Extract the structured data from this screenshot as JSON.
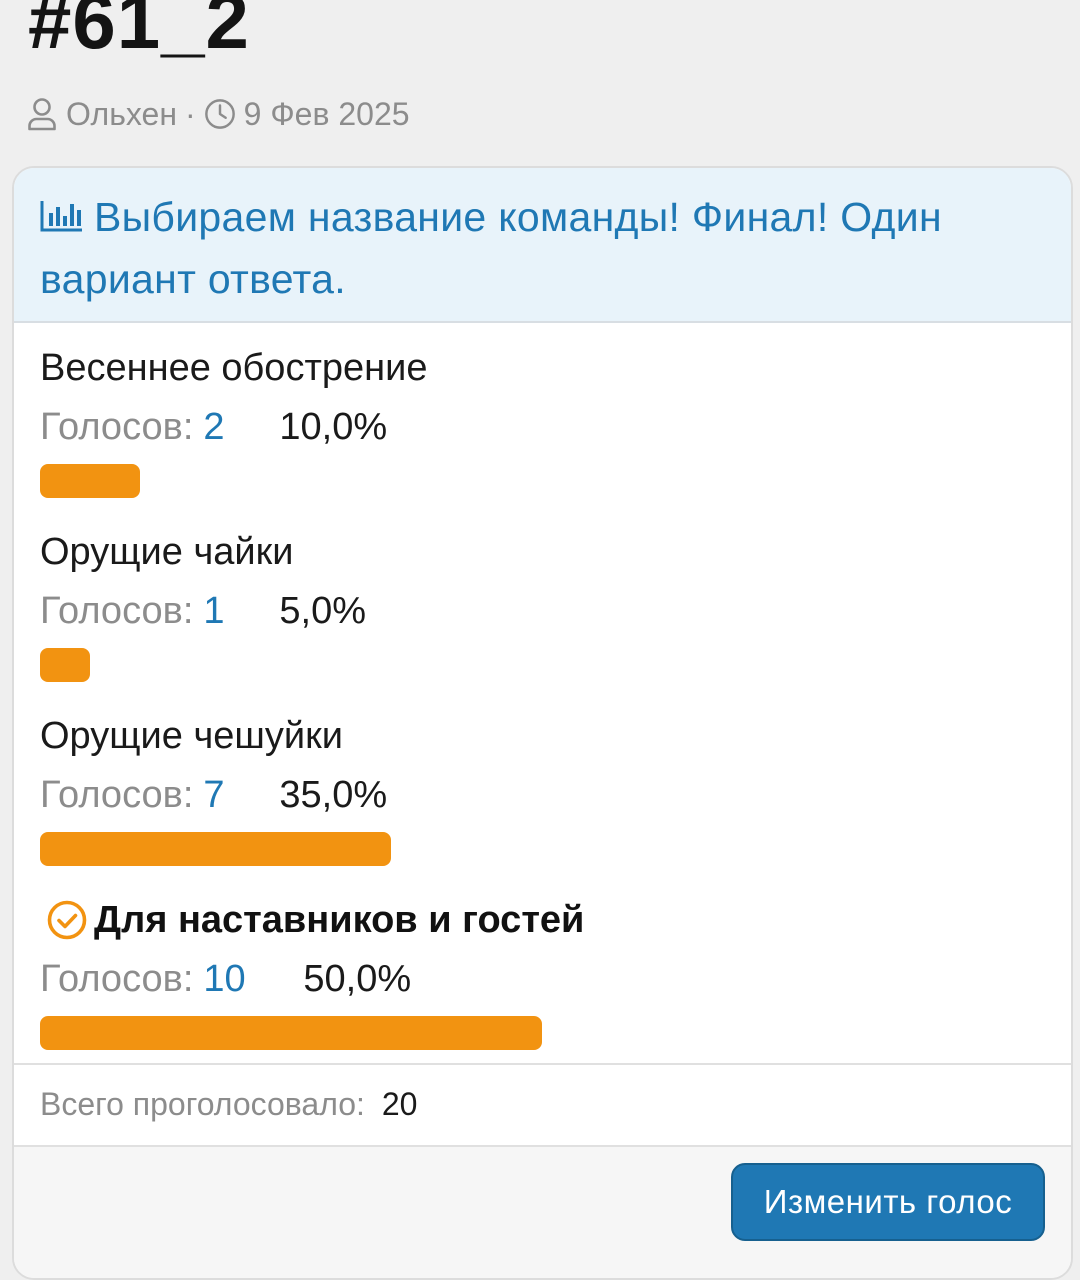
{
  "thread": {
    "title": "#61_2",
    "author": "Ольхен",
    "separator": "·",
    "date": "9 Фев 2025"
  },
  "poll": {
    "question": "Выбираем название команды! Финал! Один вариант ответа.",
    "votes_label": "Голосов:",
    "options": [
      {
        "label": "Весеннее обострение",
        "votes": "2",
        "percent": "10,0%",
        "share": 0.1,
        "selected": false
      },
      {
        "label": "Орущие чайки",
        "votes": "1",
        "percent": "5,0%",
        "share": 0.05,
        "selected": false
      },
      {
        "label": "Орущие чешуйки",
        "votes": "7",
        "percent": "35,0%",
        "share": 0.35,
        "selected": false
      },
      {
        "label": "Для наставников и гостей",
        "votes": "10",
        "percent": "50,0%",
        "share": 0.5,
        "selected": true
      }
    ],
    "total_label": "Всего проголосовало:",
    "total_value": "20",
    "change_vote_label": "Изменить голос"
  },
  "colors": {
    "accent": "#1f78b4",
    "bar": "#f29311",
    "header_bg": "#e8f3fa",
    "muted_text": "#8c8c8c"
  },
  "icons": {
    "author": "user-icon",
    "date": "clock-icon",
    "poll": "bar-chart-icon",
    "voted": "check-circle-icon"
  }
}
